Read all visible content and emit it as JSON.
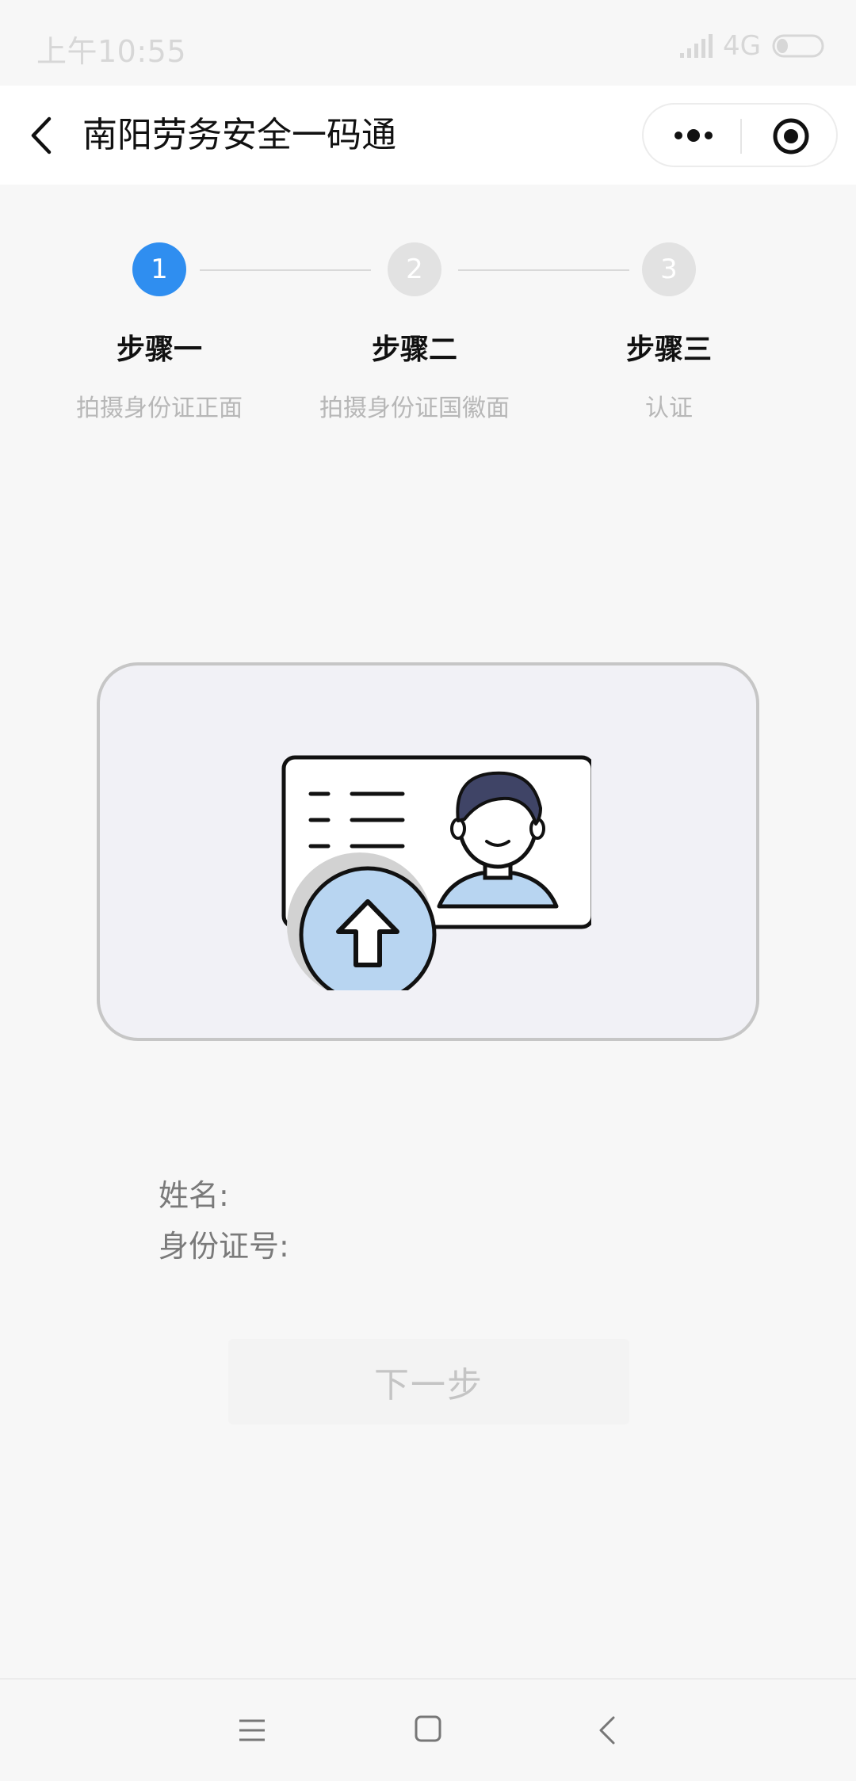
{
  "status_bar": {
    "time": "上午10:55",
    "network": "4G"
  },
  "nav": {
    "title": "南阳劳务安全一码通"
  },
  "steps": [
    {
      "number": "1",
      "title": "步骤一",
      "desc": "拍摄身份证正面",
      "active": true
    },
    {
      "number": "2",
      "title": "步骤二",
      "desc": "拍摄身份证国徽面",
      "active": false
    },
    {
      "number": "3",
      "title": "步骤三",
      "desc": "认证",
      "active": false
    }
  ],
  "info": {
    "name_label": "姓名:",
    "id_label": "身份证号:"
  },
  "next_button": "下一步",
  "colors": {
    "accent": "#2f8ef0",
    "upload_circle": "#b8d5f1",
    "hair": "#3f4466",
    "shirt": "#b8d5f1"
  }
}
